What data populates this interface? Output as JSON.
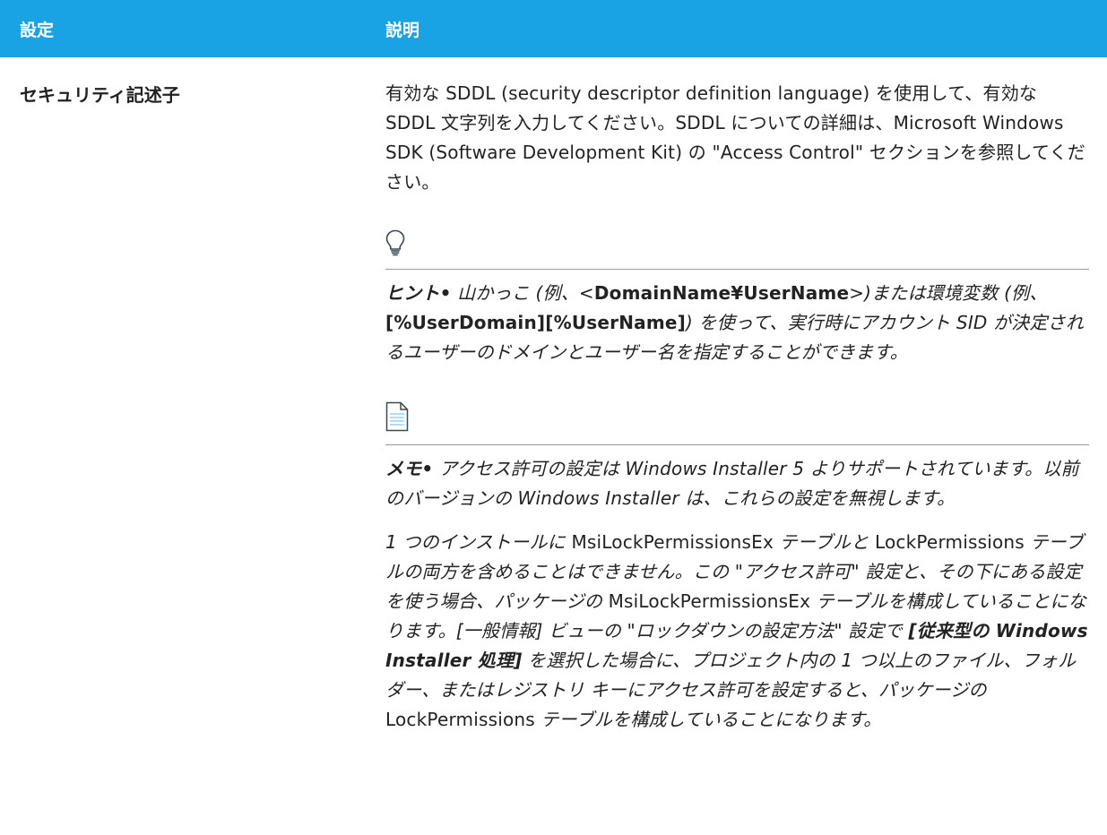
{
  "header": {
    "col_setting": "設定",
    "col_description": "説明"
  },
  "row": {
    "setting": "セキュリティ記述子",
    "description": "有効な SDDL (security descriptor definition language) を使用して、有効な SDDL 文字列を入力してください。SDDL についての詳細は、Microsoft Windows SDK (Software Development Kit) の \"Access Control\" セクションを参照してください。"
  },
  "tip": {
    "icon": "lightbulb-icon",
    "lead": "ヒント•",
    "t1": " 山かっこ (例、<",
    "b1": "DomainName¥UserName",
    "t2": ">)または環境変数 (例、",
    "b2": "[%UserDomain][%UserName]",
    "t3": ") を使って、実行時にアカウント SID が決定されるユーザーのドメインとユーザー名を指定することができます。"
  },
  "note": {
    "icon": "document-icon",
    "lead": "メモ•",
    "text": " アクセス許可の設定は Windows Installer 5 よりサポートされています。以前のバージョンの Windows Installer は、これらの設定を無視します。"
  },
  "para": {
    "p1": "1 つのインストールに ",
    "u1": "MsiLockPermissionsEx",
    "p2": " テーブルと ",
    "u2": "LockPermissions",
    "p3": " テーブルの両方を含めることはできません。この \"アクセス許可\" 設定と、その下にある設定を使う場合、パッケージの ",
    "u3": "MsiLockPermissionsEx",
    "p4": " テーブルを構成していることになります。[一般情報] ビューの \"ロックダウンの設定方法\" 設定で ",
    "b1": "[従来型の Windows Installer 処理]",
    "p5": " を選択した場合に、プロジェクト内の 1 つ以上のファイル、フォルダー、またはレジストリ キーにアクセス許可を設定すると、パッケージの",
    "u4": "LockPermissions",
    "p6": " テーブルを構成していることになります。"
  },
  "colors": {
    "header_bg": "#1aa3e4",
    "header_text": "#ffffff",
    "body_text": "#222222"
  }
}
